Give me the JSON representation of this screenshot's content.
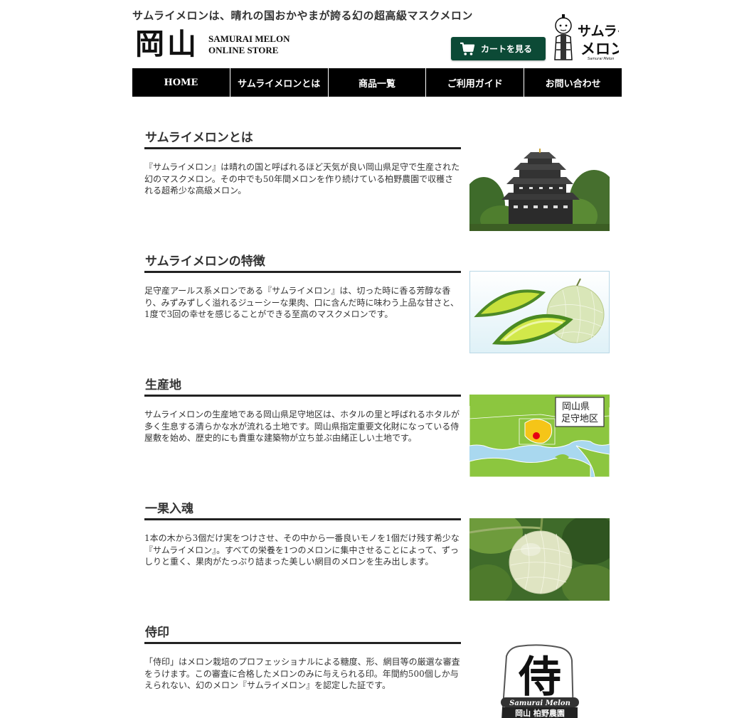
{
  "header": {
    "tagline": "サムライメロンは、晴れの国おかやまが誇る幻の超高級マスクメロン",
    "logo_kanji": "岡山",
    "logo_en_line1": "SAMURAI MELON",
    "logo_en_line2": "ONLINE STORE",
    "cart_label": "カートを見る",
    "samurai_logo_text": "サムライメロン",
    "samurai_logo_sub": "Samurai Melon"
  },
  "nav": {
    "items": [
      "HOME",
      "サムライメロンとは",
      "商品一覧",
      "ご利用ガイド",
      "お問い合わせ"
    ]
  },
  "sections": [
    {
      "title": "サムライメロンとは",
      "text": "『サムライメロン』は晴れの国と呼ばれるほど天気が良い岡山県足守で生産された幻のマスクメロン。その中でも50年間メロンを作り続けている柏野農園で収穫される超希少な高級メロン。",
      "image": "okayama-castle"
    },
    {
      "title": "サムライメロンの特徴",
      "text": "足守産アールス系メロンである『サムライメロン』は、切った時に香る芳醇な香り、みずみずしく溢れるジューシーな果肉、口に含んだ時に味わう上品な甘さと、1度で3回の幸せを感じることができる至高のマスクメロンです。",
      "image": "cut-melon"
    },
    {
      "title": "生産地",
      "text": "サムライメロンの生産地である岡山県足守地区は、ホタルの里と呼ばれるホタルが多く生息する清らかな水が流れる土地です。岡山県指定重要文化財になっている侍屋敷を始め、歴史的にも貴重な建築物が立ち並ぶ由緒正しい土地です。",
      "image": "map",
      "map_label_line1": "岡山県",
      "map_label_line2": "足守地区"
    },
    {
      "title": "一果入魂",
      "text": "1本の木から3個だけ実をつけさせ、その中から一番良いモノを1個だけ残す希少な『サムライメロン』。すべての栄養を1つのメロンに集中させることによって、ずっしりと重く、果肉がたっぷり詰まった美しい網目のメロンを生み出します。",
      "image": "melon-on-vine"
    },
    {
      "title": "侍印",
      "text": "「侍印」はメロン栽培のプロフェッショナルによる糖度、形、網目等の厳選な審査をうけます。この審査に合格したメロンのみに与えられる印。年間約500個しか与えられない、幻のメロン『サムライメロン』を認定した証です。",
      "image": "samurai-seal",
      "seal_kanji": "侍",
      "seal_en": "Samurai Melon",
      "seal_farm": "岡山 柏野農園"
    }
  ],
  "colors": {
    "nav_bg": "#000000",
    "cart_bg": "#0c4a36",
    "rule": "#222222",
    "map_sea": "#a9d8ef",
    "map_land": "#8cc63f",
    "map_highlight": "#f5c518",
    "map_marker": "#e60012"
  }
}
